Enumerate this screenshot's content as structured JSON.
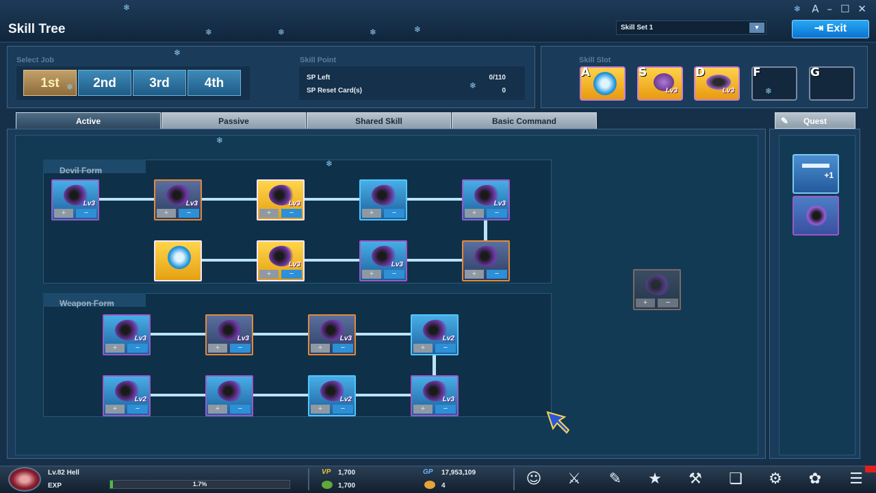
{
  "window": {
    "title": "Skill Tree",
    "controls": [
      "A",
      "–",
      "☐",
      "✕"
    ]
  },
  "skill_set": {
    "value": "Skill Set 1",
    "arrow": "▼"
  },
  "exit": {
    "icon": "⇥",
    "label": "Exit"
  },
  "select_job": {
    "label": "Select Job",
    "tabs": [
      "1st",
      "2nd",
      "3rd",
      "4th"
    ],
    "selected": "1st"
  },
  "skill_point": {
    "label": "Skill Point",
    "sp_left_label": "SP Left",
    "sp_left_value": "0/110",
    "reset_label": "SP Reset Card(s)",
    "reset_value": "0"
  },
  "skill_slot": {
    "label": "Skill Slot",
    "keys": [
      "A",
      "S",
      "D",
      "F",
      "G"
    ],
    "levels": [
      "",
      "Lv3",
      "Lv3",
      "",
      ""
    ]
  },
  "tabs": [
    "Active",
    "Passive",
    "Shared Skill",
    "Basic Command"
  ],
  "quest_tab": "Quest",
  "groups": [
    "Devil Form",
    "Weapon Form"
  ],
  "skill_buttons": {
    "plus": "+",
    "minus": "−"
  },
  "quest_items": [
    "+1",
    ""
  ],
  "skills": {
    "devil_row1": [
      "Lv3",
      "Lv3",
      "Lv3",
      "",
      "Lv3"
    ],
    "devil_row2": [
      "",
      "Lv3",
      "Lv3",
      ""
    ],
    "weapon_row1": [
      "Lv3",
      "Lv3",
      "Lv3",
      "Lv2"
    ],
    "weapon_row2": [
      "Lv2",
      "",
      "Lv2",
      "Lv3"
    ]
  },
  "status": {
    "level": "Lv.82 Hell",
    "exp_label": "EXP",
    "exp_percent": "1.7%",
    "exp_fraction": 0.017,
    "vp_label": "VP",
    "vp_value": "1,700",
    "second_value": "1,700",
    "gp_label": "GP",
    "gp_value": "17,953,109",
    "coin_value": "4"
  },
  "bottom_icons": [
    "character-icon",
    "crossed-swords-icon",
    "inventory-icon",
    "gift-icon",
    "hammer-icon",
    "book-icon",
    "guild-icon",
    "cat-icon",
    "menu-icon"
  ]
}
